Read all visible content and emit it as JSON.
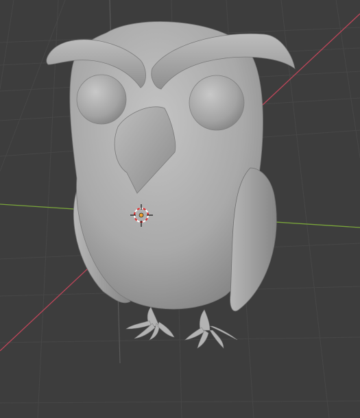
{
  "viewport": {
    "view": "3D Viewport",
    "shading": "solid",
    "background_color": "#3d3d3d",
    "grid_color": "#474747",
    "x_axis_color": "#c0465a",
    "y_axis_color": "#7aa53b",
    "z_axis_visible": true
  },
  "scene": {
    "object_shape": "owl",
    "object_color": "#a8a8a8",
    "cursor_icon": "3d-cursor-icon",
    "origin_icon": "object-origin-icon"
  }
}
